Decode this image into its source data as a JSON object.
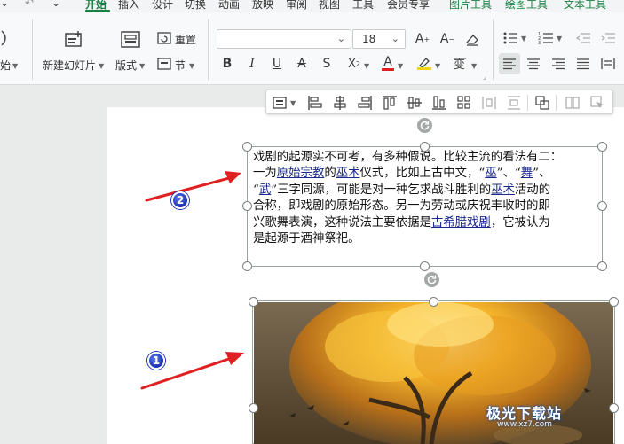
{
  "tabs": [
    {
      "label": "开始",
      "active": true
    },
    {
      "label": "插入"
    },
    {
      "label": "设计"
    },
    {
      "label": "切换"
    },
    {
      "label": "动画"
    },
    {
      "label": "放映"
    },
    {
      "label": "审阅"
    },
    {
      "label": "视图"
    },
    {
      "label": "工具"
    },
    {
      "label": "会员专享"
    },
    {
      "label": "图片工具"
    },
    {
      "label": "绘图工具"
    },
    {
      "label": "文本工具"
    }
  ],
  "ribbon": {
    "start_partial": "始",
    "new_slide": "新建幻灯片",
    "layout": "版式",
    "reset": "重置",
    "section": "节",
    "font_size": "18",
    "font_name": ""
  },
  "textbox": {
    "lines": [
      [
        "戏剧的起源实不可考，有多种假说。比较主流的看法有二："
      ],
      [
        "一为",
        {
          "link": "原始宗教"
        },
        "的",
        {
          "link": "巫术"
        },
        "仪式，比如上古中文，“",
        {
          "link": "巫"
        },
        "”、“",
        {
          "link": "舞"
        },
        "”、"
      ],
      [
        "“",
        {
          "link": "武"
        },
        "”三字同源，可能是对一种乞求战斗胜利的",
        {
          "link": "巫术"
        },
        "活动的"
      ],
      [
        "合称，即戏剧的原始形态。另一为劳动或庆祝丰收时的即"
      ],
      [
        "兴歌舞表演，这种说法主要依据是",
        {
          "link": "古希腊戏剧"
        },
        "，它被认为"
      ],
      [
        "是起源于酒神祭祀。"
      ]
    ]
  },
  "annotations": {
    "badge_1": "1",
    "badge_2": "2",
    "arrow_color": "#e02020",
    "badge_color": "#1b2fb3"
  },
  "watermark": {
    "title": "极光下载站",
    "subtitle": "www.xz7.com"
  },
  "colors": {
    "accent": "#1a7f43",
    "link": "#1a2a8a"
  }
}
